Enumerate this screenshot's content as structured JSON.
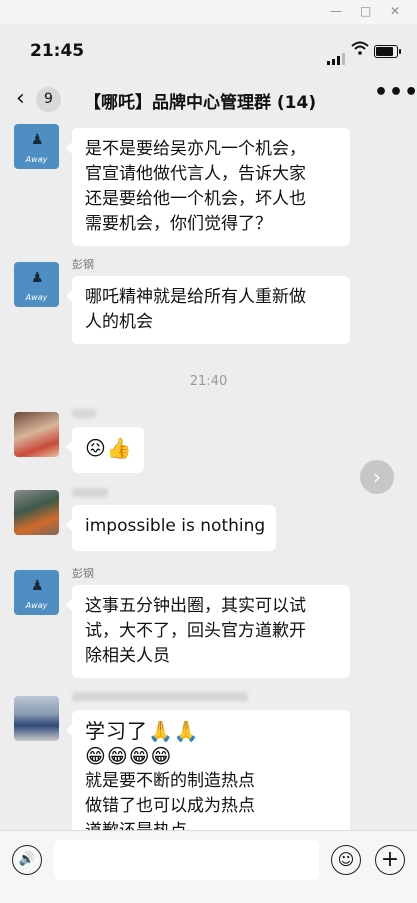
{
  "window": {
    "minimize": "—",
    "maximize": "□",
    "close": "✕"
  },
  "status": {
    "time": "21:45",
    "wifi_icon": "wifi-icon",
    "battery_icon": "battery-icon"
  },
  "nav": {
    "back_icon": "‹",
    "unread_count": "9",
    "title": "【哪吒】品牌中心管理群 (14)",
    "more_icon": "•••"
  },
  "messages": [
    {
      "sender": "",
      "avatar": "away",
      "lines": [
        "是不是要给吴亦凡一个机会，",
        "官宣请他做代言人，告诉大家",
        "还是要给他一个机会，坏人也",
        "需要机会，你们觉得了？"
      ]
    },
    {
      "sender": "彭钢",
      "avatar": "away",
      "lines": [
        "哪吒精神就是给所有人重新做",
        "人的机会"
      ]
    },
    {
      "timestamp": "21:40"
    },
    {
      "sender": "",
      "avatar": "photo",
      "lines": [
        "😖👍"
      ]
    },
    {
      "sender": "",
      "avatar": "photo",
      "lines": [
        "impossible is nothing"
      ]
    },
    {
      "sender": "彭钢",
      "avatar": "away",
      "lines": [
        "这事五分钟出圈，其实可以试",
        "试，大不了，回头官方道歉开",
        "除相关人员"
      ]
    },
    {
      "sender": "",
      "avatar": "photo",
      "lines": [
        "学习了🙏🙏",
        "😁😁😁😁",
        "就是要不断的制造热点",
        "做错了也可以成为热点",
        "道歉还是热点"
      ]
    }
  ],
  "avatar_label": "Away",
  "forward_icon": "›",
  "input": {
    "voice_icon": "🔊",
    "emoji_icon": "☺",
    "plus_icon": "+"
  }
}
